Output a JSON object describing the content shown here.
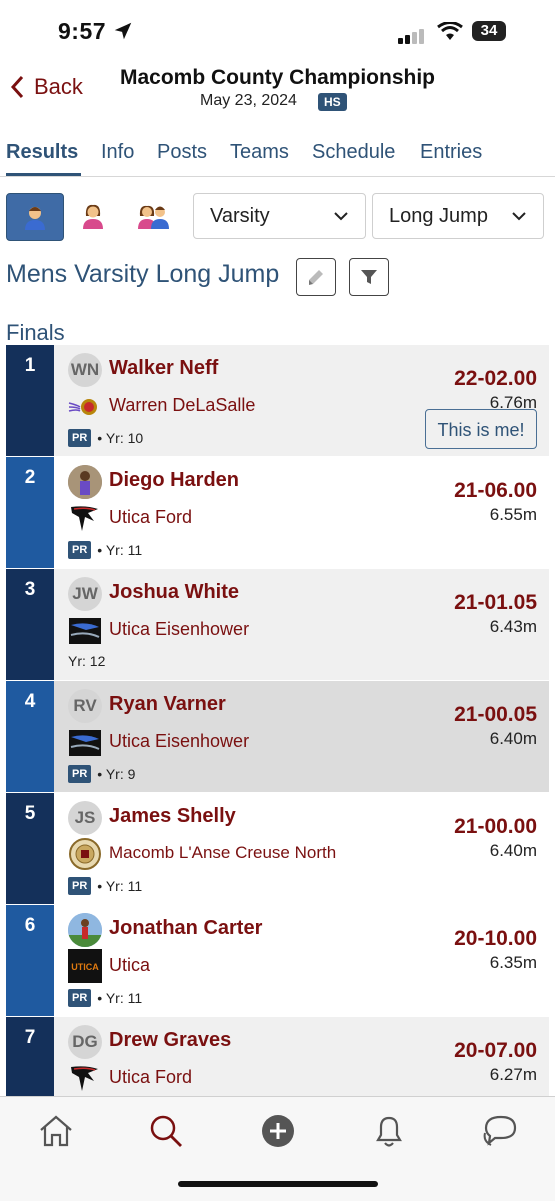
{
  "status": {
    "time": "9:57",
    "battery": "34"
  },
  "header": {
    "back_label": "Back",
    "title": "Macomb County Championship",
    "date": "May 23, 2024",
    "badge": "HS"
  },
  "tabs": [
    "Results",
    "Info",
    "Posts",
    "Teams",
    "Schedule",
    "Entries"
  ],
  "filters": {
    "level": "Varsity",
    "event": "Long Jump"
  },
  "heading": "Mens Varsity Long Jump",
  "section": "Finals",
  "this_is_me": "This is me!",
  "colors": {
    "maroon": "#7a1010",
    "navy": "#2f5377",
    "rank_dark": "#14305a",
    "rank_light": "#1f5aa0"
  },
  "results": [
    {
      "rank": "1",
      "initials": "WN",
      "name": "Walker Neff",
      "team": "Warren DeLaSalle",
      "pr": "PR",
      "year": "• Yr: 10",
      "mark": "22-02.00",
      "metric": "6.76m"
    },
    {
      "rank": "2",
      "initials": "",
      "name": "Diego Harden",
      "team": "Utica Ford",
      "pr": "PR",
      "year": "• Yr: 11",
      "mark": "21-06.00",
      "metric": "6.55m"
    },
    {
      "rank": "3",
      "initials": "JW",
      "name": "Joshua White",
      "team": "Utica Eisenhower",
      "pr": "",
      "year": "Yr: 12",
      "mark": "21-01.05",
      "metric": "6.43m"
    },
    {
      "rank": "4",
      "initials": "RV",
      "name": "Ryan Varner",
      "team": "Utica Eisenhower",
      "pr": "PR",
      "year": "• Yr: 9",
      "mark": "21-00.05",
      "metric": "6.40m"
    },
    {
      "rank": "5",
      "initials": "JS",
      "name": "James Shelly",
      "team": "Macomb L'Anse Creuse North",
      "pr": "PR",
      "year": "• Yr: 11",
      "mark": "21-00.00",
      "metric": "6.40m"
    },
    {
      "rank": "6",
      "initials": "",
      "name": "Jonathan Carter",
      "team": "Utica",
      "pr": "PR",
      "year": "• Yr: 11",
      "mark": "20-10.00",
      "metric": "6.35m"
    },
    {
      "rank": "7",
      "initials": "DG",
      "name": "Drew Graves",
      "team": "Utica Ford",
      "pr": "",
      "year": "",
      "mark": "20-07.00",
      "metric": "6.27m"
    }
  ],
  "team_logo_texts": {
    "utica": "UTICA"
  }
}
